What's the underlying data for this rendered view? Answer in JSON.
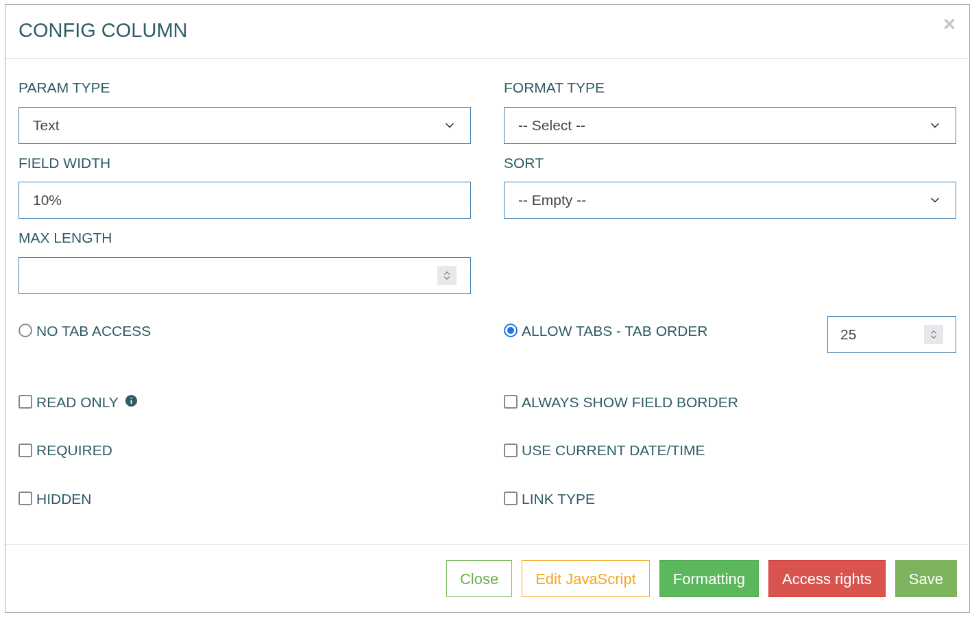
{
  "dialog": {
    "title": "CONFIG COLUMN"
  },
  "fields": [
    {
      "label": "PARAM TYPE",
      "kind": "select",
      "value": "Text"
    },
    {
      "label": "FORMAT TYPE",
      "kind": "select",
      "value": "-- Select --"
    },
    {
      "label": "FIELD WIDTH",
      "kind": "text",
      "value": "10%"
    },
    {
      "label": "SORT",
      "kind": "select",
      "value": "-- Empty --"
    },
    {
      "label": "MAX LENGTH",
      "kind": "number"
    }
  ],
  "tab_access": [
    {
      "label": "NO TAB ACCESS",
      "selected": false
    },
    {
      "label": "ALLOW TABS - TAB ORDER",
      "selected": true,
      "tab_order": "25"
    }
  ],
  "checkboxes": [
    {
      "label": "READ ONLY",
      "checked": false,
      "info": true
    },
    {
      "label": "ALWAYS SHOW FIELD BORDER",
      "checked": false,
      "info": false
    },
    {
      "label": "REQUIRED",
      "checked": false,
      "info": false
    },
    {
      "label": "USE CURRENT DATE/TIME",
      "checked": false,
      "info": false
    },
    {
      "label": "HIDDEN",
      "checked": false,
      "info": false
    },
    {
      "label": "LINK TYPE",
      "checked": false,
      "info": false
    }
  ],
  "buttons": [
    {
      "label": "Close",
      "kind": "outline-green"
    },
    {
      "label": "Edit JavaScript",
      "kind": "outline-orange"
    },
    {
      "label": "Formatting",
      "kind": "green"
    },
    {
      "label": "Access rights",
      "kind": "red"
    },
    {
      "label": "Save",
      "kind": "olive"
    }
  ]
}
